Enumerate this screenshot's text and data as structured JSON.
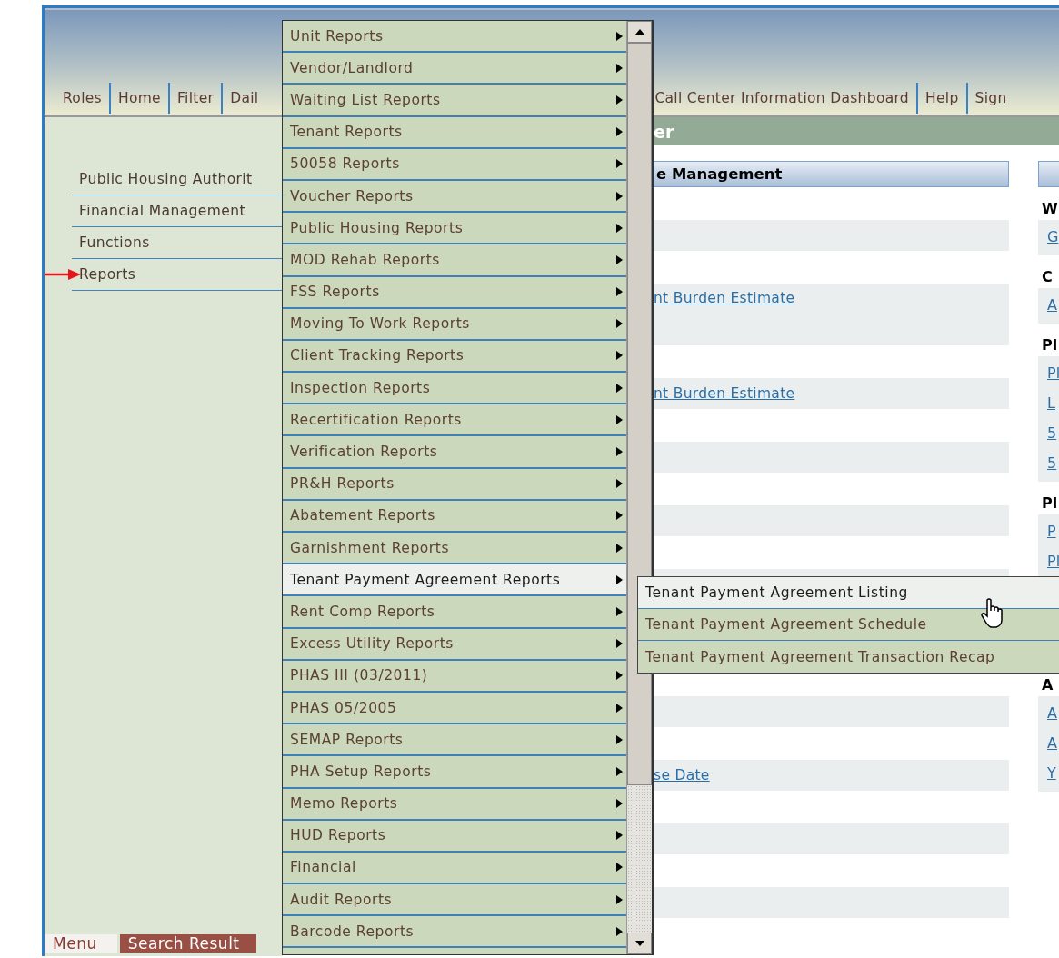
{
  "header": {
    "nav_left": [
      "Roles",
      "Home",
      "Filter",
      "Dail"
    ],
    "nav_right": [
      "Call Center Information Dashboard",
      "Help",
      "Sign"
    ]
  },
  "sidebar": {
    "items": [
      {
        "label": "Public Housing Authorit",
        "pointed": false
      },
      {
        "label": "Financial Management",
        "pointed": false
      },
      {
        "label": "Functions",
        "pointed": false
      },
      {
        "label": "Reports",
        "pointed": true
      }
    ],
    "tabs": [
      {
        "label": "Menu",
        "selected": true
      },
      {
        "label": "Search Result",
        "selected": false
      }
    ]
  },
  "main": {
    "title": "er",
    "panel": {
      "header": "e Management",
      "rows": [
        {
          "kind": "normal"
        },
        {
          "kind": "tall",
          "link": "nt Burden Estimate"
        },
        {
          "kind": "normal",
          "link": "nt Burden Estimate"
        },
        {
          "kind": "normal"
        },
        {
          "kind": "normal"
        },
        {
          "kind": "normal"
        },
        {
          "kind": "normal"
        },
        {
          "kind": "normal",
          "link": "se Date"
        },
        {
          "kind": "normal"
        },
        {
          "kind": "normal"
        }
      ]
    },
    "side": {
      "groups": [
        {
          "heading": "W",
          "links": [
            "G"
          ]
        },
        {
          "heading": "C",
          "links": [
            "A"
          ]
        },
        {
          "heading": "Pl",
          "links": [
            "Pl",
            "L",
            "5",
            "5"
          ]
        },
        {
          "heading": "Pl",
          "links": [
            "P",
            "Pl"
          ]
        },
        {
          "heading": "A",
          "links": [
            "A",
            "A",
            "Y"
          ]
        }
      ]
    }
  },
  "reports_menu": {
    "items": [
      {
        "label": "Unit Reports",
        "selected": false
      },
      {
        "label": "Vendor/Landlord",
        "selected": false
      },
      {
        "label": "Waiting List Reports",
        "selected": false
      },
      {
        "label": "Tenant Reports",
        "selected": false
      },
      {
        "label": "50058 Reports",
        "selected": false
      },
      {
        "label": "Voucher Reports",
        "selected": false
      },
      {
        "label": "Public Housing Reports",
        "selected": false
      },
      {
        "label": "MOD Rehab Reports",
        "selected": false
      },
      {
        "label": "FSS Reports",
        "selected": false
      },
      {
        "label": "Moving To Work Reports",
        "selected": false
      },
      {
        "label": "Client Tracking Reports",
        "selected": false
      },
      {
        "label": "Inspection Reports",
        "selected": false
      },
      {
        "label": "Recertification Reports",
        "selected": false
      },
      {
        "label": "Verification Reports",
        "selected": false
      },
      {
        "label": "PR&H Reports",
        "selected": false
      },
      {
        "label": "Abatement Reports",
        "selected": false
      },
      {
        "label": "Garnishment Reports",
        "selected": false
      },
      {
        "label": "Tenant Payment Agreement Reports",
        "selected": true
      },
      {
        "label": "Rent Comp Reports",
        "selected": false
      },
      {
        "label": "Excess Utility Reports",
        "selected": false
      },
      {
        "label": "PHAS III (03/2011)",
        "selected": false
      },
      {
        "label": "PHAS 05/2005",
        "selected": false
      },
      {
        "label": "SEMAP Reports",
        "selected": false
      },
      {
        "label": "PHA Setup Reports",
        "selected": false
      },
      {
        "label": "Memo Reports",
        "selected": false
      },
      {
        "label": "HUD Reports",
        "selected": false
      },
      {
        "label": "Financial",
        "selected": false
      },
      {
        "label": "Audit Reports",
        "selected": false
      },
      {
        "label": "Barcode Reports",
        "selected": false
      }
    ]
  },
  "submenu": {
    "items": [
      {
        "label": "Tenant Payment Agreement Listing",
        "selected": true
      },
      {
        "label": "Tenant Payment Agreement Schedule",
        "selected": false
      },
      {
        "label": "Tenant Payment Agreement Transaction Recap",
        "selected": false
      }
    ]
  }
}
